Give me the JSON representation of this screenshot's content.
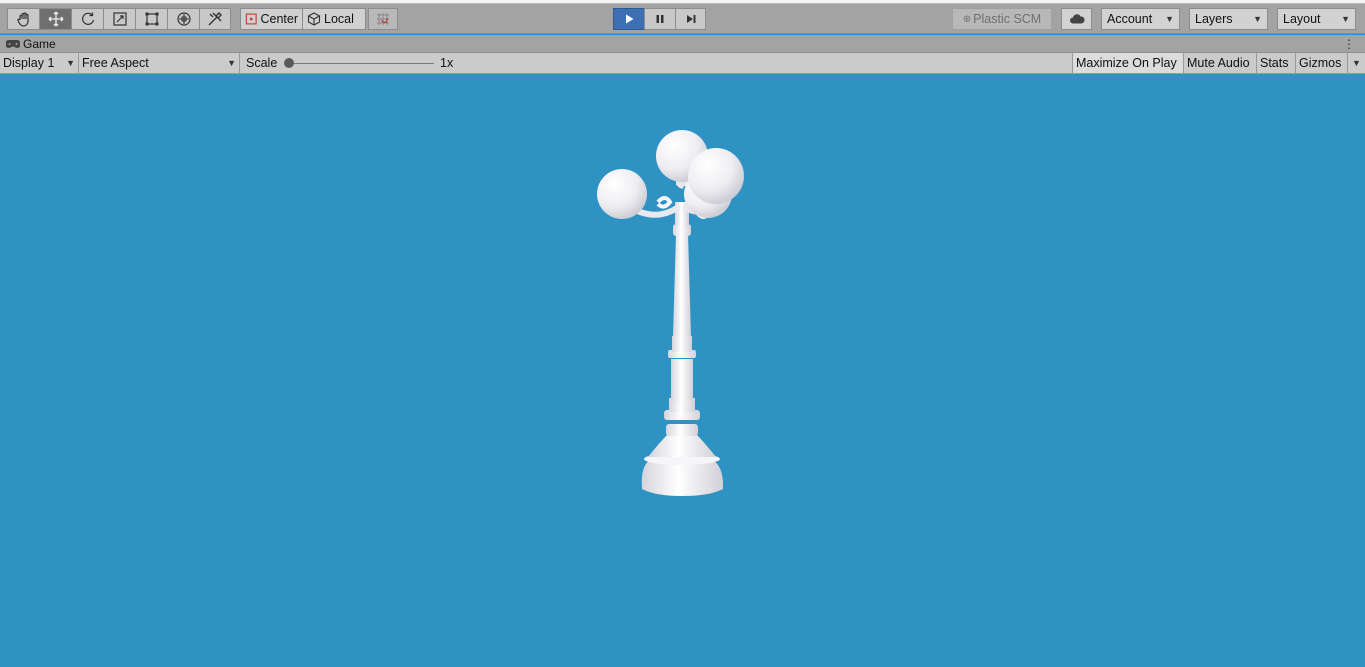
{
  "toolbar": {
    "tools": [
      {
        "name": "hand-tool",
        "icon": "hand-icon",
        "active": false
      },
      {
        "name": "move-tool",
        "icon": "move-icon",
        "active": true
      },
      {
        "name": "rotate-tool",
        "icon": "rotate-icon",
        "active": false
      },
      {
        "name": "scale-tool",
        "icon": "scale-icon",
        "active": false
      },
      {
        "name": "rect-tool",
        "icon": "rect-icon",
        "active": false
      },
      {
        "name": "transform-tool",
        "icon": "transform-icon",
        "active": false
      },
      {
        "name": "custom-tool",
        "icon": "tools-icon",
        "active": false
      }
    ],
    "pivot_mode": "Center",
    "pivot_rotation": "Local",
    "snap_icon": "grid-snap-icon",
    "play_state": "playing",
    "plastic_scm": "Plastic SCM",
    "cloud_icon": "cloud-icon",
    "account": "Account",
    "layers": "Layers",
    "layout": "Layout"
  },
  "tab": {
    "icon": "gamepad-icon",
    "title": "Game",
    "menu_icon": "kebab-menu-icon"
  },
  "gamebar": {
    "display": "Display 1",
    "aspect": "Free Aspect",
    "scale_label": "Scale",
    "scale_value": "1x",
    "maximize_on_play": "Maximize On Play",
    "mute_audio": "Mute Audio",
    "stats": "Stats",
    "gizmos": "Gizmos"
  },
  "viewport": {
    "background_color": "#2e92c2",
    "object": "street-lamp"
  },
  "colors": {
    "toolbar": "#a3a3a3",
    "play_active": "#3c6fb3"
  }
}
